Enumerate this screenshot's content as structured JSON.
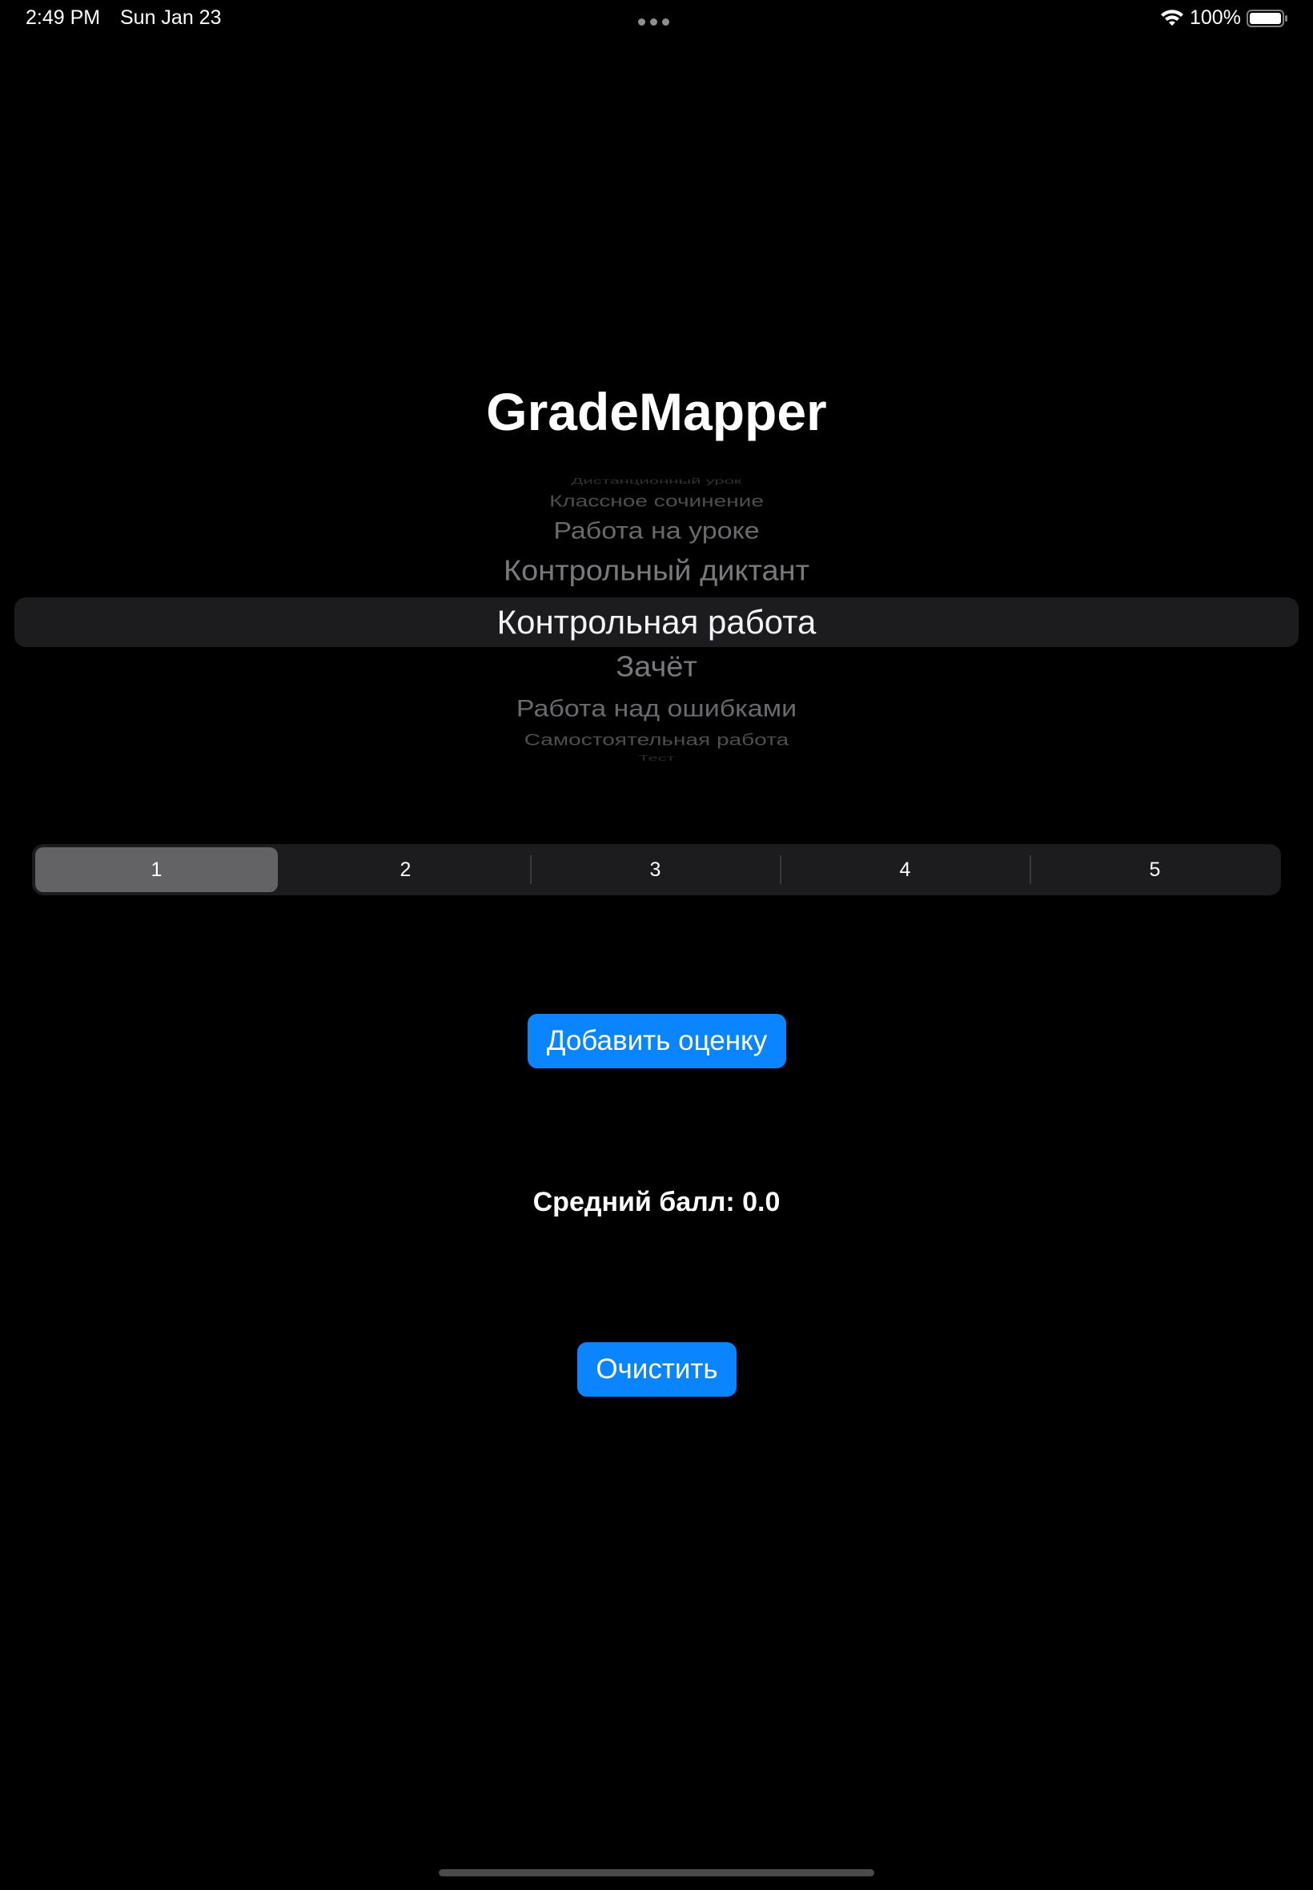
{
  "status_bar": {
    "time": "2:49 PM",
    "date": "Sun Jan 23",
    "battery": "100%",
    "icons": [
      "wifi-icon",
      "battery-icon",
      "multitasking-dots-icon"
    ]
  },
  "title": "GradeMapper",
  "picker": {
    "items": [
      "Дистанционный урок",
      "Классное сочинение",
      "Работа на уроке",
      "Контрольный диктант",
      "Контрольная работа",
      "Зачёт",
      "Работа над ошибками",
      "Самостоятельная работа",
      "Тест"
    ],
    "selected": "Контрольная работа"
  },
  "grades": {
    "options": [
      "1",
      "2",
      "3",
      "4",
      "5"
    ],
    "selected": "1"
  },
  "add_button": "Добавить оценку",
  "average": "Средний балл: 0.0",
  "clear_button": "Очистить",
  "colors": {
    "background": "#000000",
    "accent": "#0a84ff",
    "segment_selected": "#636366",
    "control_bg": "#1c1c1e"
  }
}
